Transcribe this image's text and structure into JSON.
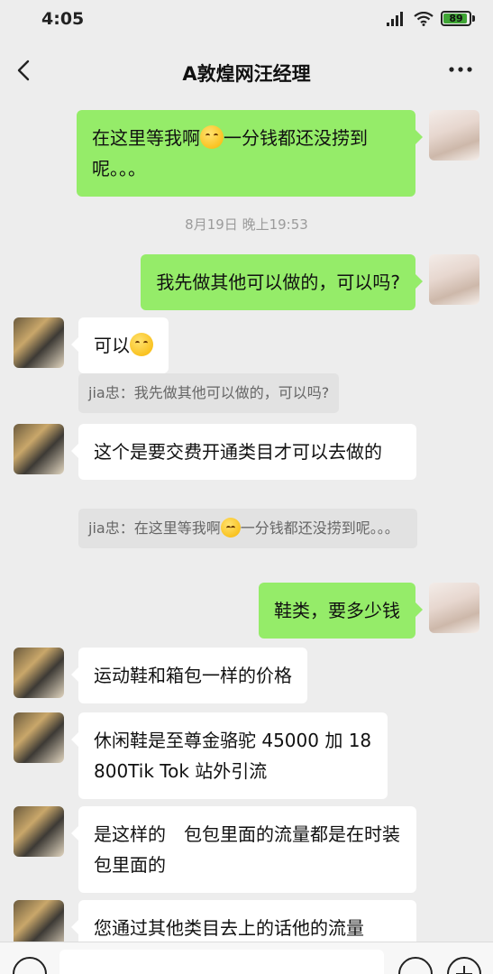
{
  "status_bar": {
    "time": "4:05",
    "battery": "89",
    "battery_color": "#3fa535",
    "icons": [
      "signal-icon",
      "wifi-icon",
      "battery-icon"
    ]
  },
  "nav": {
    "title": "A敦煌网汪经理",
    "back_icon": "back-arrow-icon",
    "more_icon": "more-dots-icon"
  },
  "timestamp": "8月19日 晚上19:53",
  "messages": [
    {
      "side": "self",
      "parts": [
        "在这里等我啊",
        "一分钱都还没捞到呢。。。"
      ],
      "emoji": "laugh-cry-emoji"
    },
    {
      "side": "self",
      "text": "我先做其他可以做的，可以吗?"
    },
    {
      "side": "other",
      "text": "可以",
      "emoji": "laugh-cry-emoji"
    },
    {
      "side": "quote",
      "text": "jia忠：我先做其他可以做的，可以吗?"
    },
    {
      "side": "other",
      "text": "这个是要交费开通类目才可以去做的"
    },
    {
      "side": "quote",
      "parts": [
        "jia忠：在这里等我啊",
        "一分钱都还没捞到呢。。。"
      ]
    },
    {
      "side": "self",
      "text": "鞋类，要多少钱"
    },
    {
      "side": "other",
      "text": "运动鞋和箱包一样的价格"
    },
    {
      "side": "other",
      "text": "休闲鞋是至尊金骆驼 45000 加 18800Tik Tok 站外引流"
    },
    {
      "side": "other",
      "text": "是这样的　包包里面的流量都是在时装包里面的"
    },
    {
      "side": "other",
      "text": "您通过其他类目去上的话他的流量"
    }
  ],
  "colors": {
    "bubble_self": "#95ec69",
    "bubble_other": "#ffffff",
    "background": "#ededed"
  }
}
